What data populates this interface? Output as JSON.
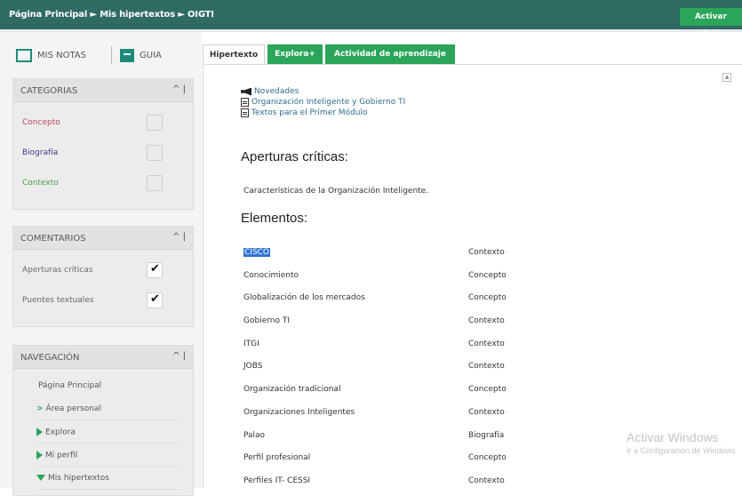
{
  "topbar": {
    "breadcrumb": "Página Principal ► Mis hipertextos ► OIGTI",
    "edit_button": "Activar edición",
    "color": "#2f6b62"
  },
  "quick_links": [
    {
      "label": "MIS NOTAS",
      "icon": "notes-icon"
    },
    {
      "label": "GUIA",
      "icon": "guide-book-icon"
    }
  ],
  "categorias": {
    "title": "CATEGORIAS",
    "controls": "^ |",
    "items": [
      {
        "label": "Concepto",
        "color": "#b8485c",
        "checked": false
      },
      {
        "label": "Biografía",
        "color": "#3a3a8a",
        "checked": false
      },
      {
        "label": "Contexto",
        "color": "#4a9a4a",
        "checked": false
      }
    ]
  },
  "comentarios": {
    "title": "COMENTARIOS",
    "controls": "^ |",
    "items": [
      {
        "label": "Aperturas críticas",
        "color": "#6a6a6a",
        "checked": true
      },
      {
        "label": "Puentes textuales",
        "color": "#6a6a6a",
        "checked": true
      }
    ]
  },
  "navegacion": {
    "title": "NAVEGACIÓN",
    "controls": "^ |",
    "root": "Página Principal",
    "items": [
      {
        "label": "Área personal",
        "marker": "chevron"
      },
      {
        "label": "Explora",
        "marker": "triangle-right"
      },
      {
        "label": "Mi perfil",
        "marker": "triangle-right"
      },
      {
        "label": "Mis hipertextos",
        "marker": "triangle-down"
      }
    ]
  },
  "tabs": [
    {
      "label": "Hipertexto",
      "active": true
    },
    {
      "label": "Explora+",
      "active": false
    },
    {
      "label": "Actividad de aprendizaje",
      "active": false
    }
  ],
  "content": {
    "links": [
      {
        "label": "Novedades",
        "icon": "announcement-icon"
      },
      {
        "label": "Organización Inteligente y Gobierno TI",
        "icon": "document-icon"
      },
      {
        "label": "Textos para el Primer Módulo",
        "icon": "document-icon"
      }
    ],
    "aperturas_title": "Aperturas críticas:",
    "aperturas_text": "Características de la Organización Inteligente.",
    "elementos_title": "Elementos:",
    "elementos": [
      {
        "name": "CISCO",
        "category": "Contexto",
        "selected": true
      },
      {
        "name": "Conocimiento",
        "category": "Concepto"
      },
      {
        "name": "Globalización de los mercados",
        "category": "Concepto"
      },
      {
        "name": "Gobierno TI",
        "category": "Contexto"
      },
      {
        "name": "ITGI",
        "category": "Contexto"
      },
      {
        "name": "JOBS",
        "category": "Contexto"
      },
      {
        "name": "Organización tradicional",
        "category": "Concepto"
      },
      {
        "name": "Organizaciones Inteligentes",
        "category": "Contexto"
      },
      {
        "name": "Palao",
        "category": "Biografía"
      },
      {
        "name": "Perfil profesional",
        "category": "Concepto"
      },
      {
        "name": "Perfiles IT- CESSI",
        "category": "Contexto"
      }
    ]
  },
  "watermark": {
    "line1": "Activar Windows",
    "line2": "Ir a Configuración de Windows"
  }
}
